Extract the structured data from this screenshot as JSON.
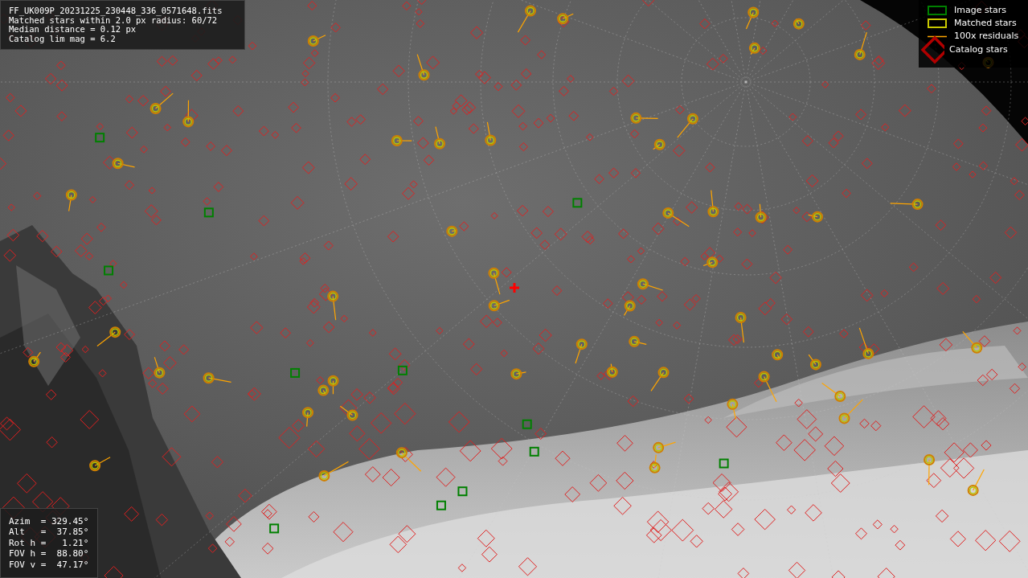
{
  "info_panel": {
    "lines": [
      "FF_UK009P_20231225_230448_336_0571648.fits",
      "Matched stars within 2.0 px radius: 60/72",
      "Median distance = 0.12 px",
      "Catalog lim mag = 6.2"
    ]
  },
  "legend": [
    {
      "kind": "box",
      "color": "#008000",
      "label": "Image stars"
    },
    {
      "kind": "box",
      "color": "#c8c800",
      "label": "Matched stars"
    },
    {
      "kind": "line",
      "color": "#ffa500",
      "label": "100x residuals"
    },
    {
      "kind": "diamond",
      "color": "#b00000",
      "label": "Catalog stars"
    }
  ],
  "pointing_panel": {
    "lines": [
      "Azim  = 329.45°",
      "Alt   =  37.85°",
      "Rot h =   1.21°",
      "FOV h =  88.80°",
      "FOV v =  47.17°"
    ]
  }
}
